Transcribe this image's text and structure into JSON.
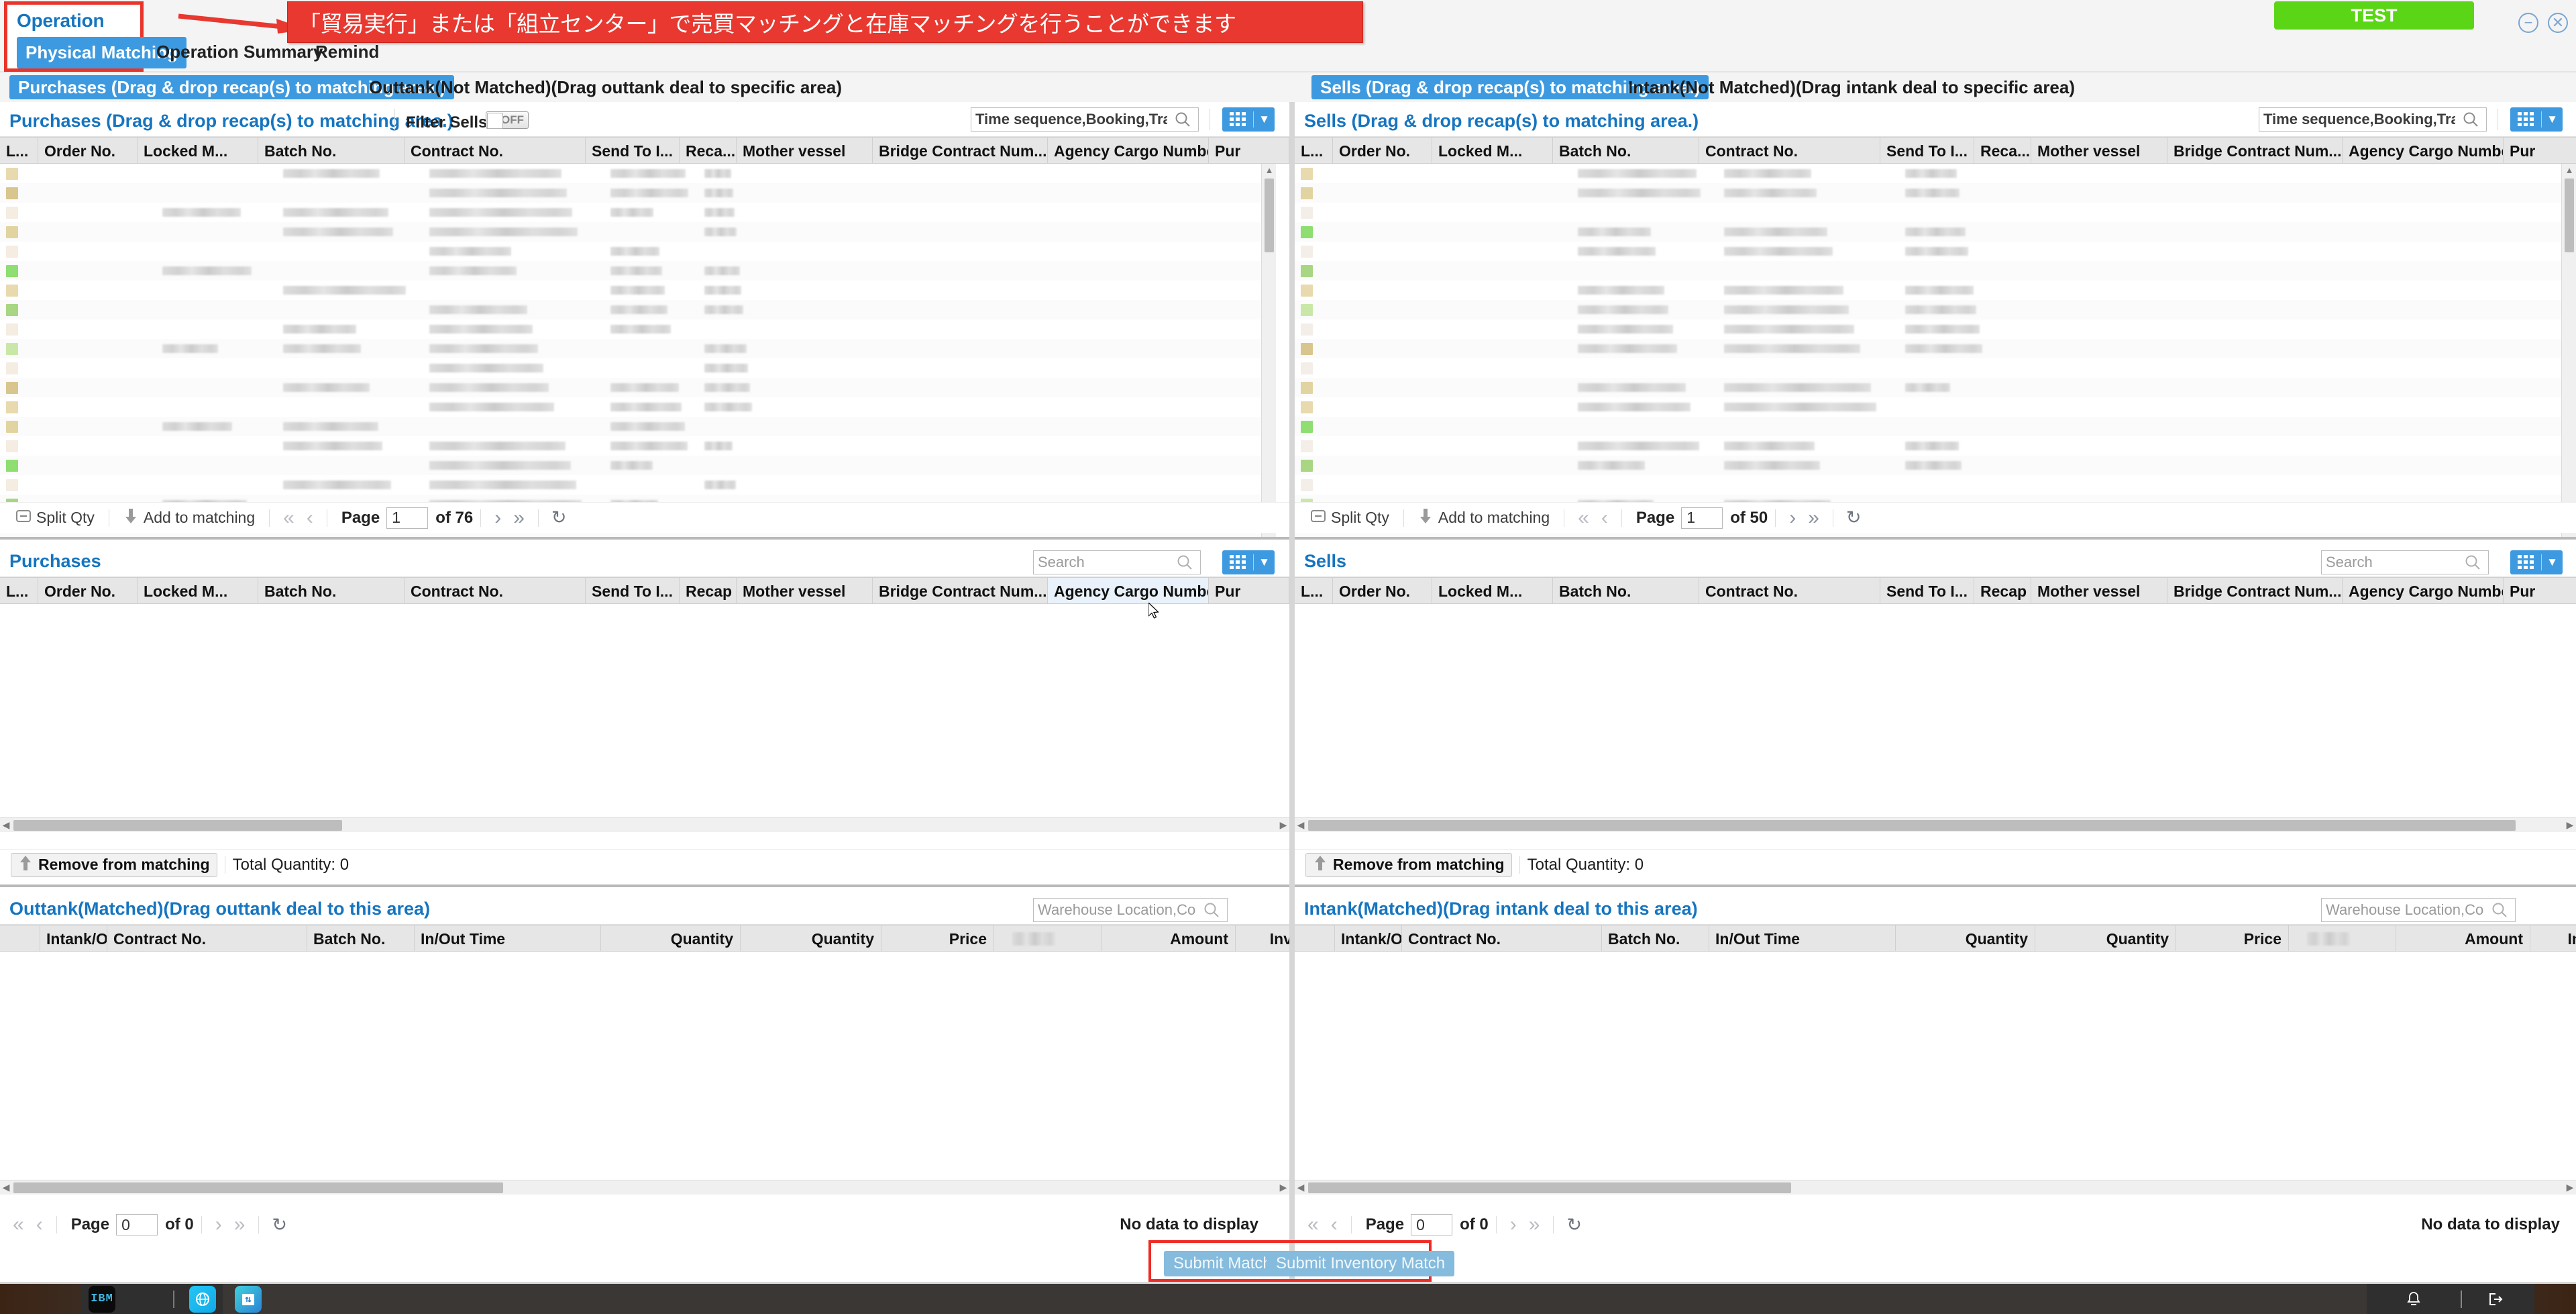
{
  "window": {
    "operation_label": "Operation",
    "banner_text": "「貿易実行」または「組立センター」で売買マッチングと在庫マッチングを行うことができます",
    "test_badge": "TEST",
    "minimize_icon": "minimize-icon",
    "close_icon": "close-icon",
    "accent_blue": "#3d9ae0",
    "annotation_red": "#e8382f",
    "test_green": "#5ad616"
  },
  "nav": {
    "tabs": [
      {
        "label": "Physical Matching",
        "active": true
      },
      {
        "label": "Operation Summary",
        "active": false
      },
      {
        "label": "Remind",
        "active": false
      }
    ]
  },
  "subtabs": {
    "left": [
      {
        "label": "Purchases (Drag & drop recap(s) to matching area.)",
        "active": true
      },
      {
        "label": "Outtank(Not Matched)(Drag outtank deal to specific area)",
        "active": false
      }
    ],
    "right": [
      {
        "label": "Sells (Drag & drop recap(s) to matching area.)",
        "active": true
      },
      {
        "label": "Intank(Not Matched)(Drag intank deal to specific area)",
        "active": false
      }
    ]
  },
  "panels": {
    "purchases_top": {
      "title": "Purchases (Drag & drop recap(s) to matching area.)",
      "filter_label": "Filter Sells:",
      "toggle_state": "OFF",
      "search_value": "Time sequence,Booking,Trader,P",
      "search_icon": "search-icon",
      "grid_icon": "grid-icon",
      "chevron_icon": "chevron-down-icon",
      "columns": [
        "L...",
        "Order No.",
        "Locked M...",
        "Batch No.",
        "Contract No.",
        "Send To I...",
        "Reca...",
        "Mother vessel",
        "Bridge Contract Num...",
        "Agency Cargo Number",
        "Pur"
      ],
      "toolbar": {
        "split_qty": "Split Qty",
        "add_to_matching": "Add to matching",
        "page_label": "Page",
        "page_value": "1",
        "page_total": "of 76",
        "first_icon": "first-page-icon",
        "prev_icon": "prev-page-icon",
        "next_icon": "next-page-icon",
        "last_icon": "last-page-icon",
        "refresh_icon": "refresh-icon"
      }
    },
    "sells_top": {
      "title": "Sells (Drag & drop recap(s) to matching area.)",
      "search_value": "Time sequence,Booking,Trader,P",
      "columns": [
        "L...",
        "Order No.",
        "Locked M...",
        "Batch No.",
        "Contract No.",
        "Send To I...",
        "Reca...",
        "Mother vessel",
        "Bridge Contract Num...",
        "Agency Cargo Number",
        "Pur"
      ],
      "toolbar": {
        "split_qty": "Split Qty",
        "add_to_matching": "Add to matching",
        "page_label": "Page",
        "page_value": "1",
        "page_total": "of 50"
      }
    },
    "purchases_mid": {
      "title": "Purchases",
      "search_placeholder": "Search",
      "columns": [
        "L...",
        "Order No.",
        "Locked M...",
        "Batch No.",
        "Contract No.",
        "Send To I...",
        "Recap",
        "Mother vessel",
        "Bridge Contract Num...",
        "Agency Cargo Number",
        "Pur"
      ],
      "remove_label": "Remove from matching",
      "total_quantity": "Total Quantity: 0"
    },
    "sells_mid": {
      "title": "Sells",
      "search_placeholder": "Search",
      "columns": [
        "L...",
        "Order No.",
        "Locked M...",
        "Batch No.",
        "Contract No.",
        "Send To I...",
        "Recap",
        "Mother vessel",
        "Bridge Contract Num...",
        "Agency Cargo Number",
        "Pur"
      ],
      "remove_label": "Remove from matching",
      "total_quantity": "Total Quantity: 0"
    },
    "outtank_matched": {
      "title": "Outtank(Matched)(Drag outtank deal to this area)",
      "search_value": "Warehouse Location,Contract No",
      "columns": [
        "Intank/Ou...",
        "Contract No.",
        "Batch No.",
        "In/Out Time",
        "Quantity",
        "Quantity",
        "Price",
        "",
        "Amount",
        "Inventory."
      ],
      "toolbar": {
        "page_label": "Page",
        "page_value": "0",
        "page_total": "of 0"
      },
      "no_data": "No data to display"
    },
    "intank_matched": {
      "title": "Intank(Matched)(Drag intank deal to this area)",
      "search_value": "Warehouse Location,Contract No",
      "columns": [
        "Intank/Ou...",
        "Contract No.",
        "Batch No.",
        "In/Out Time",
        "Quantity",
        "Quantity",
        "Price",
        "",
        "Amount",
        "Inventory"
      ],
      "toolbar": {
        "page_label": "Page",
        "page_value": "0",
        "page_total": "of 0"
      },
      "no_data": "No data to display"
    }
  },
  "footer": {
    "submit_match": "Submit Match",
    "submit_inventory_match": "Submit Inventory Match"
  },
  "taskbar": {
    "apps": [
      {
        "name": "ibm-app-icon",
        "label": "IBM"
      },
      {
        "name": "globe-app-icon",
        "label": ""
      },
      {
        "name": "box-app-icon",
        "label": ""
      }
    ],
    "tray": [
      {
        "name": "bell-icon"
      },
      {
        "name": "logout-icon"
      }
    ]
  }
}
